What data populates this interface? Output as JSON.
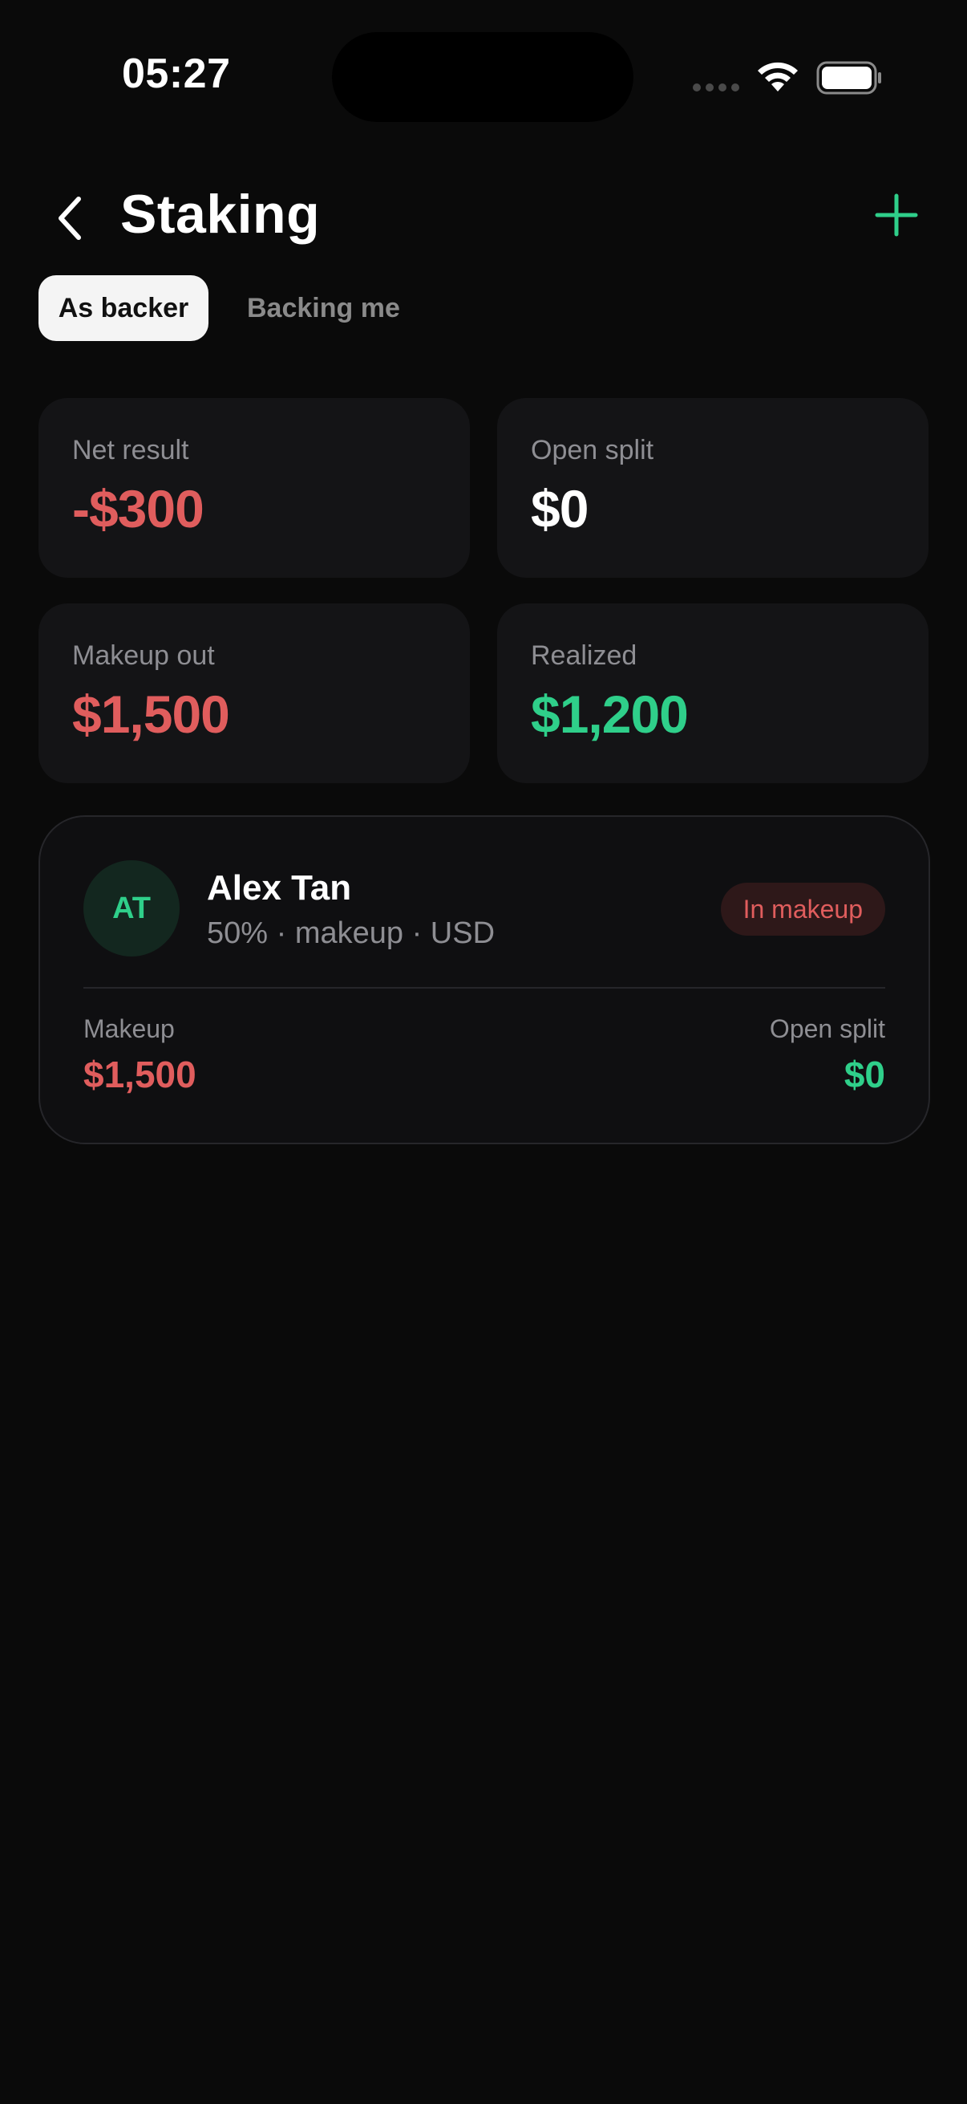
{
  "status_bar": {
    "time": "05:27"
  },
  "header": {
    "title": "Staking"
  },
  "tabs": [
    {
      "label": "As backer",
      "active": true
    },
    {
      "label": "Backing me",
      "active": false
    }
  ],
  "stats": {
    "net_result": {
      "label": "Net result",
      "value": "-$300"
    },
    "open_split": {
      "label": "Open split",
      "value": "$0"
    },
    "makeup_out": {
      "label": "Makeup out",
      "value": "$1,500"
    },
    "realized": {
      "label": "Realized",
      "value": "$1,200"
    }
  },
  "backer": {
    "initials": "AT",
    "name": "Alex Tan",
    "details": "50% · makeup · USD",
    "status": "In makeup",
    "makeup_label": "Makeup",
    "makeup_value": "$1,500",
    "open_split_label": "Open split",
    "open_split_value": "$0"
  },
  "colors": {
    "background": "#0a0a0a",
    "negative": "#e05d5d",
    "positive": "#2fcf8a",
    "card": "#141416"
  }
}
